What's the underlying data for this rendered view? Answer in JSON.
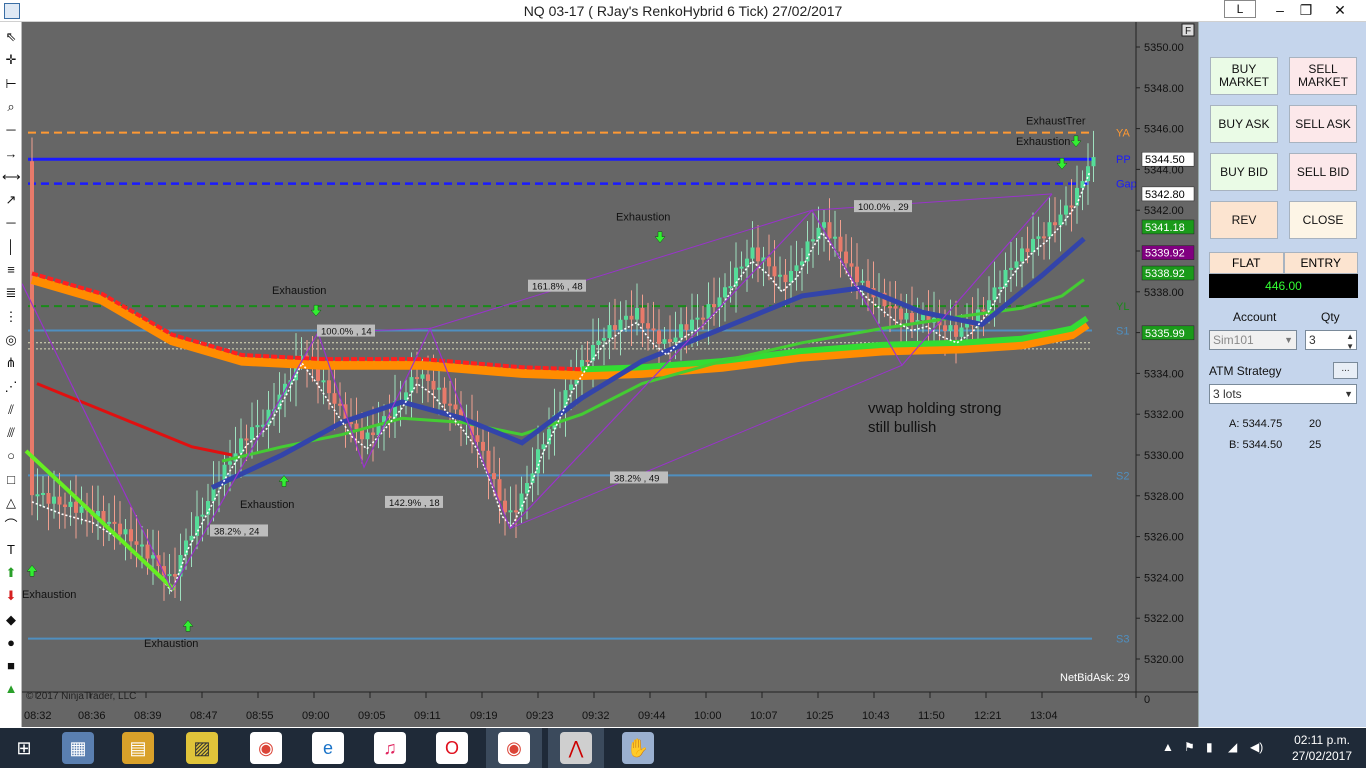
{
  "window": {
    "title": "NQ 03-17 ( RJay's RenkoHybrid  6 Tick)  27/02/2017",
    "link_button": "L",
    "minimize": "–",
    "restore": "❐",
    "close": "✕"
  },
  "toolbar_icons": [
    "cursor-icon",
    "crosshair-icon",
    "ruler-icon",
    "zoom-icon",
    "line-icon",
    "ray-icon",
    "extended-line-icon",
    "arrow-line-icon",
    "horizontal-line-icon",
    "vertical-line-icon",
    "fib-retracement-icon",
    "fib-extension-icon",
    "fib-time-icon",
    "fib-circle-icon",
    "andrews-pitchfork-icon",
    "gann-fan-icon",
    "regression-channel-icon",
    "trend-channel-icon",
    "ellipse-icon",
    "rectangle-icon",
    "triangle-icon",
    "arc-icon",
    "text-icon",
    "arrow-up-icon",
    "arrow-down-icon",
    "diamond-icon",
    "dot-icon",
    "square-icon",
    "triangle-up-icon"
  ],
  "chart_data": {
    "type": "candlestick",
    "instrument": "NQ 03-17",
    "bar_type": "RJay's RenkoHybrid 6 Tick",
    "date": "27/02/2017",
    "ylim": [
      5319,
      5351
    ],
    "y_ticks": [
      "5350.00",
      "5348.00",
      "5346.00",
      "5344.00",
      "5342.00",
      "5340.00",
      "5338.00",
      "5336.00",
      "5334.00",
      "5332.00",
      "5330.00",
      "5328.00",
      "5326.00",
      "5324.00",
      "5322.00",
      "5320.00"
    ],
    "x_ticks": [
      "08:32",
      "08:36",
      "08:39",
      "08:47",
      "08:55",
      "09:00",
      "09:05",
      "09:11",
      "09:19",
      "09:23",
      "09:32",
      "09:44",
      "10:00",
      "10:07",
      "10:25",
      "10:43",
      "11:50",
      "12:21",
      "13:04"
    ],
    "levels": [
      {
        "label": "YA",
        "value": 5345.8,
        "color": "#ff9933",
        "style": "dashed"
      },
      {
        "label": "PP",
        "value": 5344.5,
        "color": "#1a1aff",
        "style": "solid"
      },
      {
        "label": "Gap",
        "value": 5343.3,
        "color": "#1a1aff",
        "style": "dashed"
      },
      {
        "label": "YL",
        "value": 5337.3,
        "color": "#1a8a1a",
        "style": "dashed"
      },
      {
        "label": "S1",
        "value": 5336.1,
        "color": "#4f8fc0",
        "style": "solid"
      },
      {
        "label": "S2",
        "value": 5329.0,
        "color": "#4f8fc0",
        "style": "solid"
      },
      {
        "label": "S3",
        "value": 5321.0,
        "color": "#4f8fc0",
        "style": "solid"
      }
    ],
    "price_markers": [
      {
        "value": "5344.50",
        "bg": "#ffffff",
        "fg": "#000000"
      },
      {
        "value": "5342.80",
        "bg": "#ffffff",
        "fg": "#000000"
      },
      {
        "value": "5341.18",
        "bg": "#1a9a1a",
        "fg": "#ffffff"
      },
      {
        "value": "5339.92",
        "bg": "#800080",
        "fg": "#ffffff"
      },
      {
        "value": "5338.92",
        "bg": "#1a9a1a",
        "fg": "#ffffff"
      },
      {
        "value": "5335.99",
        "bg": "#1a9a1a",
        "fg": "#ffffff"
      }
    ],
    "fib_labels": [
      "100.0% , 14",
      "161.8% , 48",
      "100.0% , 29",
      "142.9% , 18",
      "38.2% , 49",
      "38.2% , 24"
    ],
    "signals": [
      "Exhaustion",
      "Exhaustion",
      "Exhaustion",
      "Exhaustion",
      "Exhaustion",
      "Exhaustion",
      "ExhaustTrer"
    ],
    "annotation": [
      "vwap holding strong",
      "still bullish"
    ],
    "net_bid_ask": "NetBidAsk: 29",
    "copyright": "© 2017 NinjaTrader, LLC",
    "axis_zero": "0",
    "corner_button": "F"
  },
  "order_panel": {
    "buy_market": "BUY MARKET",
    "sell_market": "SELL MARKET",
    "buy_ask": "BUY ASK",
    "sell_ask": "SELL ASK",
    "buy_bid": "BUY BID",
    "sell_bid": "SELL BID",
    "rev": "REV",
    "close": "CLOSE",
    "position": "FLAT",
    "entry": "ENTRY",
    "pnl": "446.00",
    "account_label": "Account",
    "qty_label": "Qty",
    "account": "Sim101",
    "qty": "3",
    "atm_label": "ATM Strategy",
    "atm_button": "...",
    "atm_value": "3 lots",
    "ask_row": {
      "label": "A: 5344.75",
      "size": "20"
    },
    "bid_row": {
      "label": "B: 5344.50",
      "size": "25"
    }
  },
  "taskbar": {
    "time": "02:11 p.m.",
    "date": "27/02/2017",
    "apps": [
      "windows-start-icon",
      "calculator-icon",
      "file-explorer-icon",
      "sticky-notes-icon",
      "chrome-icon",
      "internet-explorer-icon",
      "itunes-icon",
      "opera-icon",
      "chrome-icon",
      "ninjatrader-icon",
      "hand-tool-icon"
    ]
  }
}
